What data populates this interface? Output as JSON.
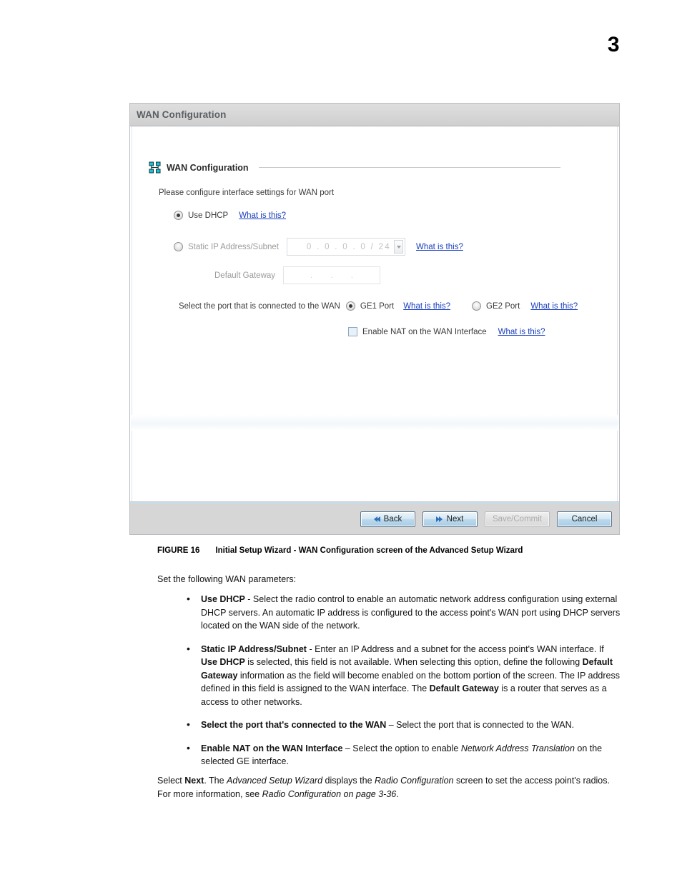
{
  "page": {
    "chapter_number": "3"
  },
  "screenshot": {
    "window_title": "WAN Configuration",
    "section": {
      "icon": "network-nodes-icon",
      "title": "WAN Configuration",
      "instructions": "Please configure interface settings for WAN port"
    },
    "options": {
      "use_dhcp": {
        "label": "Use DHCP",
        "selected": true,
        "help_link": "What is this?"
      },
      "static_ip": {
        "label": "Static IP Address/Subnet",
        "selected": false,
        "value": "0 . 0 . 0 . 0 / 24",
        "spinner_icon": "chevron-down-icon",
        "help_link": "What is this?"
      },
      "default_gateway": {
        "label": "Default Gateway",
        "value": ". . ."
      }
    },
    "port_selection": {
      "prompt": "Select the port that is connected to the WAN",
      "ge1": {
        "label": "GE1 Port",
        "selected": true,
        "help_link": "What is this?"
      },
      "ge2": {
        "label": "GE2 Port",
        "selected": false,
        "help_link": "What is this?"
      }
    },
    "nat": {
      "label": "Enable NAT on the WAN Interface",
      "checked": false,
      "help_link": "What is this?"
    },
    "buttons": {
      "back": {
        "label": "Back",
        "icon": "double-chevron-left-icon",
        "disabled": false
      },
      "next": {
        "label": "Next",
        "icon": "double-chevron-right-icon",
        "disabled": false
      },
      "save_commit": {
        "label": "Save/Commit",
        "disabled": true
      },
      "cancel": {
        "label": "Cancel",
        "disabled": false
      }
    }
  },
  "caption": {
    "figure_number": "FIGURE 16",
    "figure_title": "Initial Setup Wizard - WAN Configuration screen of the Advanced Setup Wizard"
  },
  "body": {
    "lead": "Set the following WAN parameters:",
    "bullets": [
      {
        "term": "Use DHCP",
        "text": " - Select the radio control to enable an automatic network address configuration using external DHCP servers. An automatic IP address is configured to the access point's WAN port using DHCP servers located on the WAN side of the network."
      },
      {
        "term": "Static IP Address/Subnet",
        "text": " - Enter an IP Address and a subnet for the access point's WAN interface. If Use DHCP is selected, this field is not available. When selecting this option, define the following Default Gateway information as the field will become enabled on the bottom portion of the screen. The IP address defined in this field is assigned to the WAN interface. The Default Gateway is a router that serves as a access to other networks."
      },
      {
        "term": "Select the port that's connected to the WAN",
        "text": " – Select the port that is connected to the WAN."
      },
      {
        "term": "Enable NAT on the WAN Interface",
        "text": " – Select the option to enable Network Address Translation on the selected GE interface."
      }
    ],
    "closing": "Select Next. The Advanced Setup Wizard displays the Radio Configuration screen to set the access point's radios. For more information, see Radio Configuration on page 3-36."
  }
}
